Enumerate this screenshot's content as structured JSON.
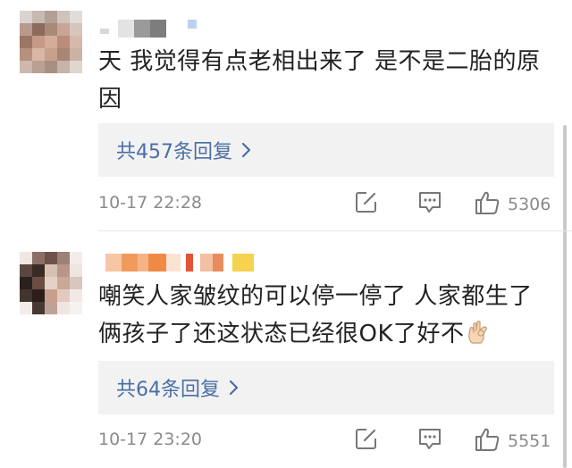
{
  "comments": [
    {
      "text": "天 我觉得有点老相出来了 是不是二胎的原因",
      "reply_label": "共457条回复",
      "timestamp": "10-17 22:28",
      "like_count": "5306"
    },
    {
      "text": "嘲笑人家皱纹的可以停一停了 人家都生了俩孩子了还这状态已经很OK了好不",
      "reply_label": "共64条回复",
      "timestamp": "10-17 23:20",
      "like_count": "5551",
      "emoji": "ok-hand-emoji"
    }
  ],
  "icons": {
    "edit": "edit-icon",
    "reply": "comment-icon",
    "like": "thumbs-up-icon",
    "chevron": "chevron-right-icon"
  },
  "colors": {
    "text": "#222222",
    "link": "#4a6fa5",
    "muted": "#8a8a8a",
    "reply_bg": "#f2f2f2"
  }
}
